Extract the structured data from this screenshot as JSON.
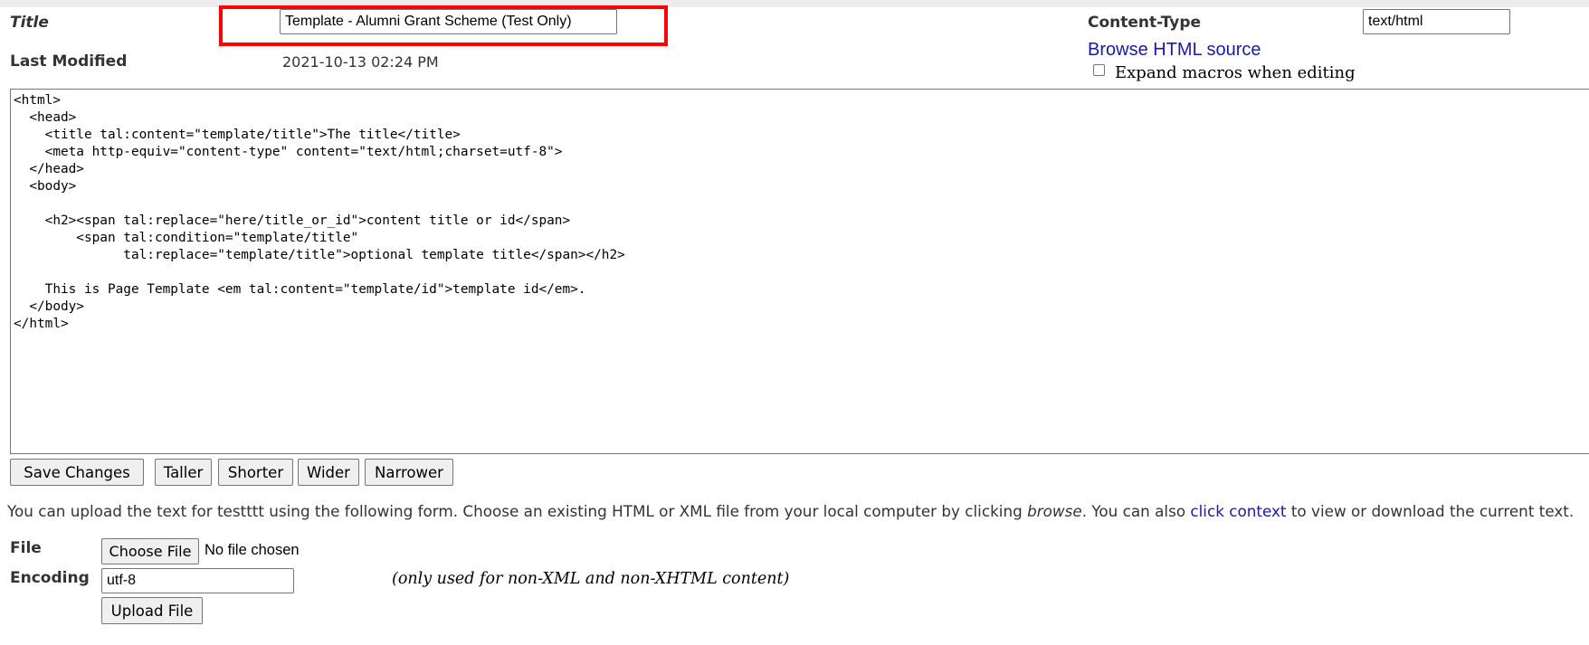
{
  "form": {
    "title_label": "Title",
    "title_value": "Template - Alumni Grant Scheme (Test Only)",
    "last_modified_label": "Last Modified",
    "last_modified_value": "2021-10-13 02:24 PM",
    "content_type_label": "Content-Type",
    "content_type_value": "text/html",
    "browse_link": "Browse HTML source",
    "expand_macros_label": "Expand macros when editing",
    "expand_macros_checked": false
  },
  "editor": {
    "source": "<html>\n  <head>\n    <title tal:content=\"template/title\">The title</title>\n    <meta http-equiv=\"content-type\" content=\"text/html;charset=utf-8\">\n  </head>\n  <body>\n\n    <h2><span tal:replace=\"here/title_or_id\">content title or id</span>\n        <span tal:condition=\"template/title\"\n              tal:replace=\"template/title\">optional template title</span></h2>\n\n    This is Page Template <em tal:content=\"template/id\">template id</em>.\n  </body>\n</html>"
  },
  "buttons": {
    "save": "Save Changes",
    "taller": "Taller",
    "shorter": "Shorter",
    "wider": "Wider",
    "narrower": "Narrower"
  },
  "upload": {
    "text_before": "You can upload the text for testttt using the following form. Choose an existing HTML or XML file from your local computer by clicking ",
    "text_browse": "browse",
    "text_middle": ". You can also ",
    "text_link": "click context",
    "text_after": " to view or download the current text.",
    "file_label": "File",
    "choose_file_button": "Choose File",
    "no_file_text": "No file chosen",
    "encoding_label": "Encoding",
    "encoding_value": "utf-8",
    "encoding_note": "(only used for non-XML and non-XHTML content)",
    "upload_button": "Upload File"
  }
}
